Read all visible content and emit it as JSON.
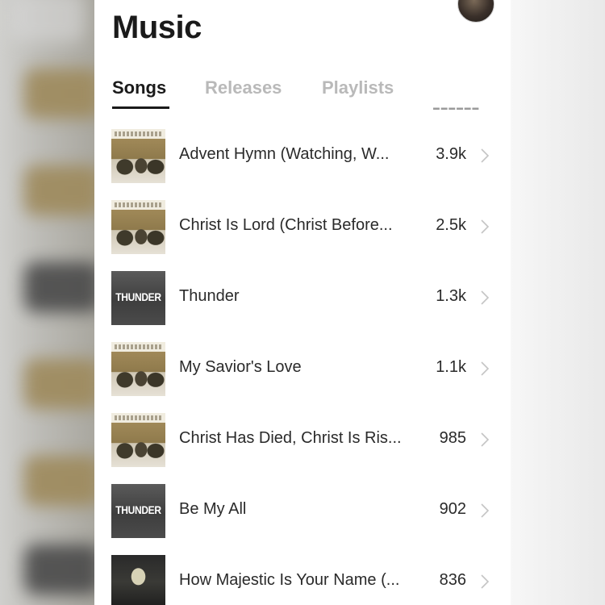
{
  "header": {
    "title": "Music"
  },
  "tabs": [
    {
      "label": "Songs",
      "active": true
    },
    {
      "label": "Releases",
      "active": false
    },
    {
      "label": "Playlists",
      "active": false
    }
  ],
  "songs": [
    {
      "title": "Advent Hymn (Watching, W...",
      "count": "3.9k",
      "art": "sepia-album-art"
    },
    {
      "title": "Christ Is Lord (Christ Before...",
      "count": "2.5k",
      "art": "sepia-album-art"
    },
    {
      "title": "Thunder",
      "count": "1.3k",
      "art": "thunder-album-art",
      "art_label": "THUNDER"
    },
    {
      "title": "My Savior's Love",
      "count": "1.1k",
      "art": "sepia-album-art"
    },
    {
      "title": "Christ Has Died, Christ Is Ris...",
      "count": "985",
      "art": "sepia-album-art"
    },
    {
      "title": "Be My All",
      "count": "902",
      "art": "thunder-album-art",
      "art_label": "THUNDER"
    },
    {
      "title": "How Majestic Is Your Name (...",
      "count": "836",
      "art": "stage-photo-album-art"
    }
  ],
  "icons": {
    "row_action": "chevron-right-icon"
  },
  "colors": {
    "text": "#1a1a1a",
    "tab_inactive": "#b9b9b9",
    "chevron": "#c4c4c4",
    "background": "#ffffff"
  }
}
